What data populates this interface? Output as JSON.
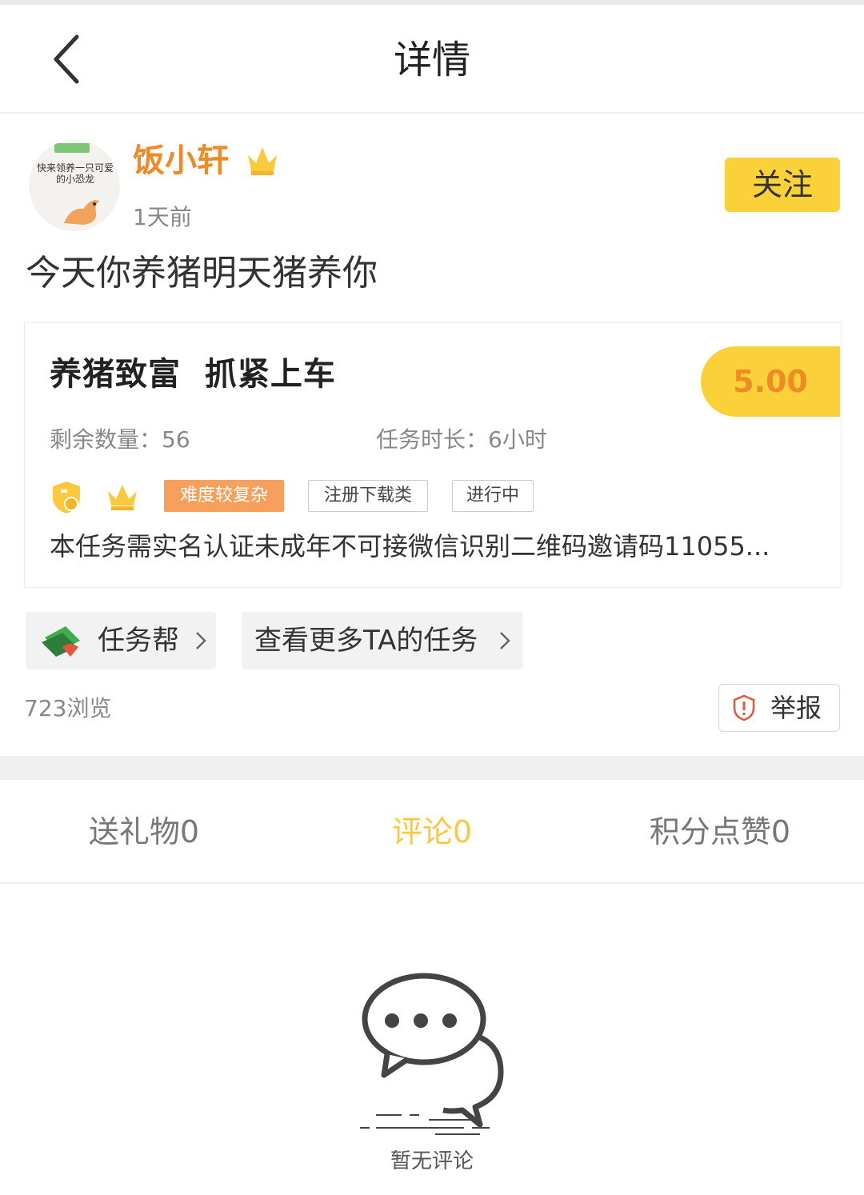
{
  "header": {
    "title": "详情"
  },
  "author": {
    "avatar_text": "快来领养一只可爱的小恐龙",
    "name": "饭小轩",
    "time": "1天前",
    "follow_label": "关注"
  },
  "post": {
    "text": "今天你养猪明天猪养你"
  },
  "task": {
    "title": "养猪致富  抓紧上车",
    "price": "5.00",
    "remaining": "剩余数量：56",
    "duration": "任务时长：6小时",
    "tags": {
      "difficulty": "难度较复杂",
      "category": "注册下载类",
      "status": "进行中"
    },
    "description": "本任务需实名认证未成年不可接微信识别二维码邀请码11055..."
  },
  "links": {
    "app_label": "任务帮",
    "more_label": "查看更多TA的任务"
  },
  "stats": {
    "views": "723浏览",
    "report_label": "举报"
  },
  "tabs": {
    "gift": "送礼物0",
    "comment": "评论0",
    "likes": "积分点赞0"
  },
  "empty": {
    "text": "暂无评论"
  },
  "colors": {
    "accent": "#fbd13a",
    "orange": "#f08a24",
    "tag_orange": "#f7a05c"
  }
}
